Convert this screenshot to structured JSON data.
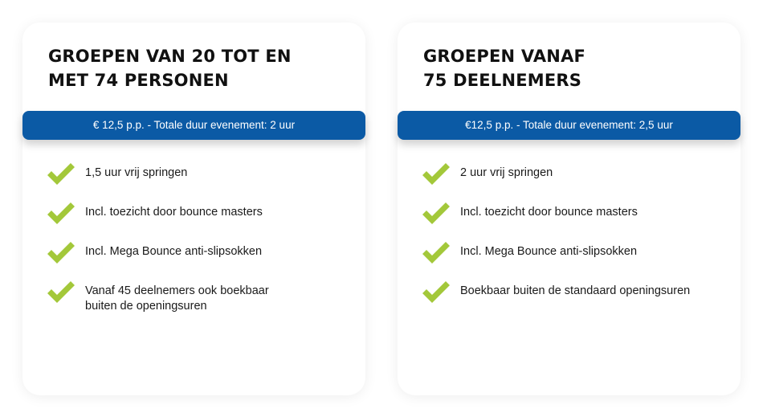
{
  "cards": [
    {
      "title_line1": "GROEPEN VAN 20 TOT EN",
      "title_line2": "MET 74 PERSONEN",
      "price_bar": "€ 12,5 p.p. - Totale duur evenement: 2 uur",
      "features": [
        "1,5 uur vrij springen",
        "Incl. toezicht door bounce masters",
        "Incl. Mega Bounce anti-slipsokken",
        "Vanaf 45 deelnemers ook boekbaar",
        "buiten de openingsuren"
      ]
    },
    {
      "title_line1": "GROEPEN VANAF",
      "title_line2": "75 DEELNEMERS",
      "price_bar": "€12,5 p.p. - Totale duur evenement: 2,5 uur",
      "features": [
        "2 uur vrij springen",
        "Incl. toezicht door bounce masters",
        "Incl. Mega Bounce anti-slipsokken",
        "Boekbaar buiten de standaard openingsuren"
      ]
    }
  ],
  "colors": {
    "accent_blue": "#0b5aa5",
    "check_green": "#a3c83a",
    "text_dark": "#111111"
  },
  "icons": {
    "feature_bullet": "checkmark-icon"
  }
}
